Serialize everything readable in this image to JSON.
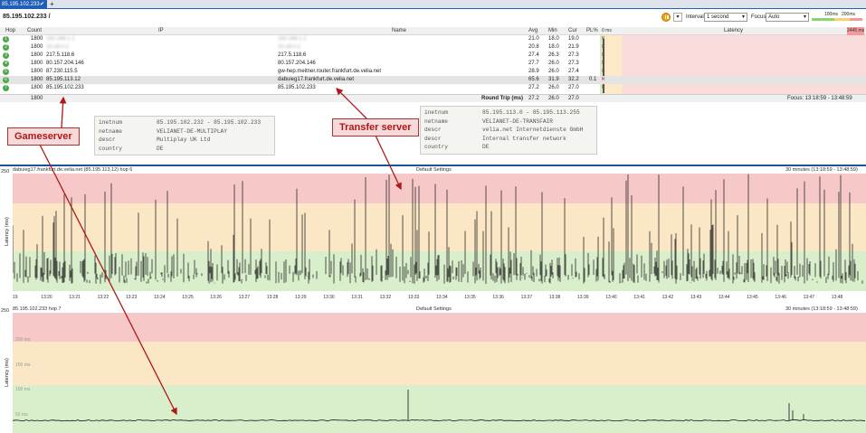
{
  "tabbar": {
    "tab_label": "85.195.102.233",
    "add_label": "+"
  },
  "toolbar": {
    "target": "85.195.102.233 /",
    "interval_label": "Interval",
    "interval_value": "1 second",
    "focus_label": "Focus",
    "focus_value": "Auto",
    "scale_low": "100ms",
    "scale_high": "200ms"
  },
  "trace": {
    "headers": {
      "hop": "Hop",
      "count": "Count",
      "ip": "IP",
      "name": "Name",
      "avg": "Avg",
      "min": "Min",
      "cur": "Cur",
      "pl": "PL%",
      "zero": "0 ms",
      "latency": "Latency",
      "max": "2445 ms"
    },
    "rows": [
      {
        "hop": "1",
        "count": "1800",
        "ip": "192.168.1.1",
        "name": "192.168.1.1",
        "avg": "21.0",
        "min": "18.0",
        "cur": "19.0",
        "pl": "",
        "blur": true
      },
      {
        "hop": "2",
        "count": "1800",
        "ip": "10.24.0.1",
        "name": "10.24.0.1",
        "avg": "20.8",
        "min": "18.0",
        "cur": "21.9",
        "pl": "",
        "blur": true
      },
      {
        "hop": "3",
        "count": "1800",
        "ip": "217.5.118.6",
        "name": "217.5.118.6",
        "avg": "27.4",
        "min": "26.3",
        "cur": "27.3",
        "pl": ""
      },
      {
        "hop": "4",
        "count": "1800",
        "ip": "80.157.204.146",
        "name": "80.157.204.146",
        "avg": "27.7",
        "min": "26.0",
        "cur": "27.3",
        "pl": ""
      },
      {
        "hop": "5",
        "count": "1800",
        "ip": "87.230.115.5",
        "name": "gw-hep.meitner.router.frankfurt.de.velia.net",
        "avg": "28.9",
        "min": "26.0",
        "cur": "27.4",
        "pl": ""
      },
      {
        "hop": "6",
        "count": "1800",
        "ip": "85.195.113.12",
        "name": "dabuieg17.frankfurt.de.velia.net",
        "avg": "65.6",
        "min": "31.9",
        "cur": "32.2",
        "pl": "0.1"
      },
      {
        "hop": "7",
        "count": "1800",
        "ip": "85.195.102.233",
        "name": "85.195.102.233",
        "avg": "27.2",
        "min": "26.0",
        "cur": "27.0",
        "pl": ""
      }
    ],
    "summary": {
      "count": "1800",
      "label": "Round Trip (ms)",
      "avg": "27.2",
      "min": "26.0",
      "cur": "27.0",
      "focus": "Focus: 13:18:59 - 13:48:59"
    }
  },
  "whois_game": {
    "rows": [
      {
        "k": "inetnum",
        "v": "85.195.102.232 - 85.195.102.233"
      },
      {
        "k": "netname",
        "v": "VELIANET-DE-MULTIPLAY"
      },
      {
        "k": "descr",
        "v": "Multiplay UK Ltd"
      },
      {
        "k": "country",
        "v": "DE"
      }
    ]
  },
  "whois_transfer": {
    "rows": [
      {
        "k": "inetnum",
        "v": "85.195.113.0 - 85.195.113.255"
      },
      {
        "k": "netname",
        "v": "VELIANET-DE-TRANSFAIR"
      },
      {
        "k": "descr",
        "v": "velia.net Internetdienste GmbH"
      },
      {
        "k": "descr",
        "v": "Internal transfer network"
      },
      {
        "k": "country",
        "v": "DE"
      }
    ]
  },
  "callouts": {
    "game": "Gameserver",
    "transfer": "Transfer server"
  },
  "graph1": {
    "title": "dabuieg17.frankfurt.de.velia.net (85.195.113.12) hop 6",
    "center": "Default Settings",
    "right": "30 minutes (13:18:59 - 13:48:59)",
    "ymax": "250",
    "ylabel": "Latency (ms)",
    "ticks": [
      "19",
      "13:20",
      "13:21",
      "13:22",
      "13:23",
      "13:24",
      "13:25",
      "13:26",
      "13:27",
      "13:28",
      "13:29",
      "13:30",
      "13:31",
      "13:32",
      "13:33",
      "13:34",
      "13:35",
      "13:36",
      "13:37",
      "13:38",
      "13:39",
      "13:40",
      "13:41",
      "13:42",
      "13:43",
      "13:44",
      "13:45",
      "13:46",
      "13:47",
      "13:48"
    ]
  },
  "graph2": {
    "title": "85.195.102.233 hop 7",
    "center": "Default Settings",
    "right": "30 minutes (13:18:59 - 13:48:59)",
    "ymax": "250",
    "ylabel": "Latency (ms)",
    "gridlabels": [
      "200 ms",
      "150 ms",
      "100 ms",
      "50 ms"
    ]
  },
  "chart_data": [
    {
      "type": "line",
      "title": "dabuieg17.frankfurt.de.velia.net (85.195.113.12) hop 6",
      "ylabel": "Latency (ms)",
      "ylim": [
        0,
        250
      ],
      "x_range": [
        "13:18:59",
        "13:48:59"
      ],
      "series": [
        {
          "values_summary": "baseline ~30 ms with frequent spikes up to 250 ms"
        }
      ]
    },
    {
      "type": "line",
      "title": "85.195.102.233 hop 7",
      "ylabel": "Latency (ms)",
      "ylim": [
        0,
        250
      ],
      "x_range": [
        "13:18:59",
        "13:48:59"
      ],
      "series": [
        {
          "values_summary": "flat ~27 ms with two spikes around 70 ms"
        }
      ]
    }
  ],
  "colors": {
    "red_band": "#f6c8c8",
    "yellow_band": "#fbe6c5",
    "green_band": "#d9efcc",
    "accent": "#1f5fb8",
    "arrow": "#b01818"
  }
}
